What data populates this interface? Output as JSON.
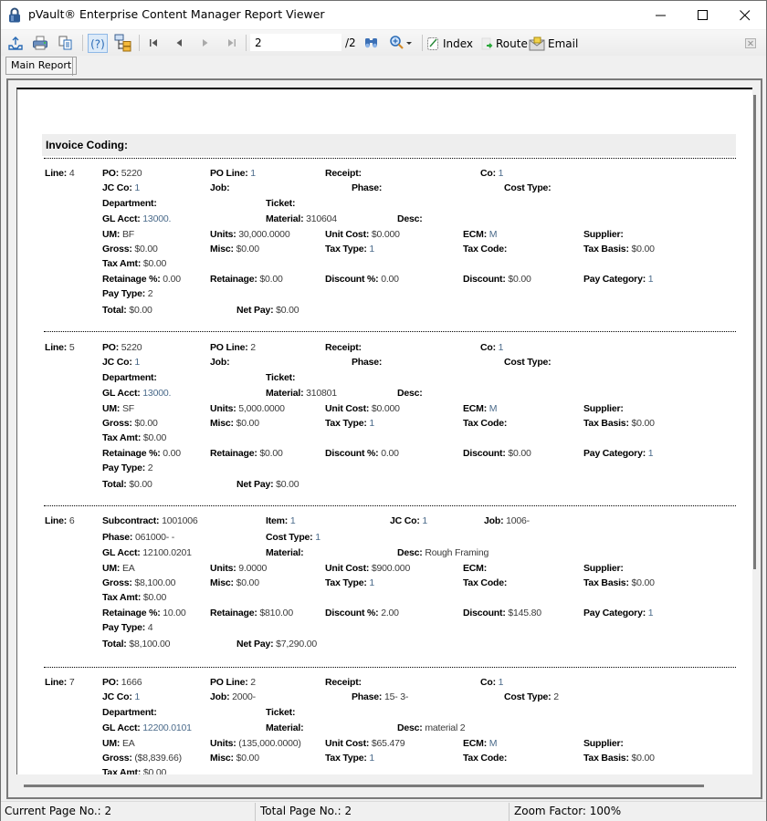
{
  "window": {
    "title": "pVault® Enterprise Content Manager Report Viewer",
    "controls": {
      "minimize": "minimize-icon",
      "maximize": "maximize-icon",
      "close": "close-icon"
    }
  },
  "toolbar": {
    "icons": [
      "export-icon",
      "print-icon",
      "copy-icon",
      "help-icon",
      "tree-toggle-icon",
      "first-page-icon",
      "prev-page-icon",
      "next-page-icon",
      "last-page-icon",
      "search-binoculars-icon",
      "zoom-icon",
      "zoom-dropdown-icon"
    ],
    "page_input_value": "2",
    "page_total": "/2",
    "index_label": "Index",
    "route_label": "Route",
    "email_label": "Email"
  },
  "tabs": [
    {
      "label": "Main Report",
      "active": true
    }
  ],
  "report": {
    "section_title": "Invoice Coding:",
    "lines": [
      {
        "type": "po",
        "line": "4",
        "po": "5220",
        "po_line": "1",
        "receipt": "",
        "co": "1",
        "jc_co": "1",
        "job": "",
        "phase": "",
        "cost_type": "",
        "department": "",
        "ticket": "",
        "gl_acct": "13000.",
        "material": "310604",
        "desc": "",
        "um": "BF",
        "units": "30,000.0000",
        "unit_cost": "$0.000",
        "ecm": "M",
        "supplier": "",
        "gross": "$0.00",
        "misc": "$0.00",
        "tax_type": "1",
        "tax_code": "",
        "tax_basis": "$0.00",
        "tax_amt": "$0.00",
        "retainage_pct": "0.00",
        "retainage": "$0.00",
        "discount_pct": "0.00",
        "discount": "$0.00",
        "pay_category": "1",
        "pay_type": "2",
        "total": "$0.00",
        "net_pay": "$0.00"
      },
      {
        "type": "po",
        "line": "5",
        "po": "5220",
        "po_line": "2",
        "receipt": "",
        "co": "1",
        "jc_co": "1",
        "job": "",
        "phase": "",
        "cost_type": "",
        "department": "",
        "ticket": "",
        "gl_acct": "13000.",
        "material": "310801",
        "desc": "",
        "um": "SF",
        "units": "5,000.0000",
        "unit_cost": "$0.000",
        "ecm": "M",
        "supplier": "",
        "gross": "$0.00",
        "misc": "$0.00",
        "tax_type": "1",
        "tax_code": "",
        "tax_basis": "$0.00",
        "tax_amt": "$0.00",
        "retainage_pct": "0.00",
        "retainage": "$0.00",
        "discount_pct": "0.00",
        "discount": "$0.00",
        "pay_category": "1",
        "pay_type": "2",
        "total": "$0.00",
        "net_pay": "$0.00"
      },
      {
        "type": "subcontract",
        "line": "6",
        "subcontract": "1001006",
        "item": "1",
        "jc_co": "1",
        "job": "1006-",
        "phase": "061000-  -",
        "cost_type": "1",
        "gl_acct": "12100.0201",
        "material": "",
        "desc": "Rough Framing",
        "um": "EA",
        "units": "9.0000",
        "unit_cost": "$900.000",
        "ecm": "",
        "supplier": "",
        "gross": "$8,100.00",
        "misc": "$0.00",
        "tax_type": "1",
        "tax_code": "",
        "tax_basis": "$0.00",
        "tax_amt": "$0.00",
        "retainage_pct": "10.00",
        "retainage": "$810.00",
        "discount_pct": "2.00",
        "discount": "$145.80",
        "pay_category": "1",
        "pay_type": "4",
        "total": "$8,100.00",
        "net_pay": "$7,290.00"
      },
      {
        "type": "po",
        "line": "7",
        "po": "1666",
        "po_line": "2",
        "receipt": "",
        "co": "1",
        "jc_co": "1",
        "job": "2000-",
        "phase": "15- 3-",
        "cost_type": "2",
        "department": "",
        "ticket": "",
        "gl_acct": "12200.0101",
        "material": "",
        "desc": "material 2",
        "um": "EA",
        "units": "(135,000.0000)",
        "unit_cost": "$65.479",
        "ecm": "M",
        "supplier": "",
        "gross": "($8,839.66)",
        "misc": "$0.00",
        "tax_type": "1",
        "tax_code": "",
        "tax_basis": "$0.00",
        "tax_amt": "$0.00"
      }
    ],
    "labels": {
      "line": "Line:",
      "po": "PO:",
      "po_line": "PO Line:",
      "receipt": "Receipt:",
      "co": "Co:",
      "jc_co": "JC Co:",
      "job": "Job:",
      "phase": "Phase:",
      "cost_type": "Cost Type:",
      "department": "Department:",
      "ticket": "Ticket:",
      "gl_acct": "GL Acct:",
      "material": "Material:",
      "desc": "Desc:",
      "um": "UM:",
      "units": "Units:",
      "unit_cost": "Unit Cost:",
      "ecm": "ECM:",
      "supplier": "Supplier:",
      "gross": "Gross:",
      "misc": "Misc:",
      "tax_type": "Tax Type:",
      "tax_code": "Tax Code:",
      "tax_basis": "Tax Basis:",
      "tax_amt": "Tax Amt:",
      "retainage_pct": "Retainage %:",
      "retainage": "Retainage:",
      "discount_pct": "Discount %:",
      "discount": "Discount:",
      "pay_category": "Pay Category:",
      "pay_type": "Pay Type:",
      "total": "Total:",
      "net_pay": "Net Pay:",
      "subcontract": "Subcontract:",
      "item": "Item:"
    }
  },
  "statusbar": {
    "current_page": "Current Page No.: 2",
    "total_pages": "Total Page No.: 2",
    "zoom": "Zoom Factor: 100%"
  }
}
